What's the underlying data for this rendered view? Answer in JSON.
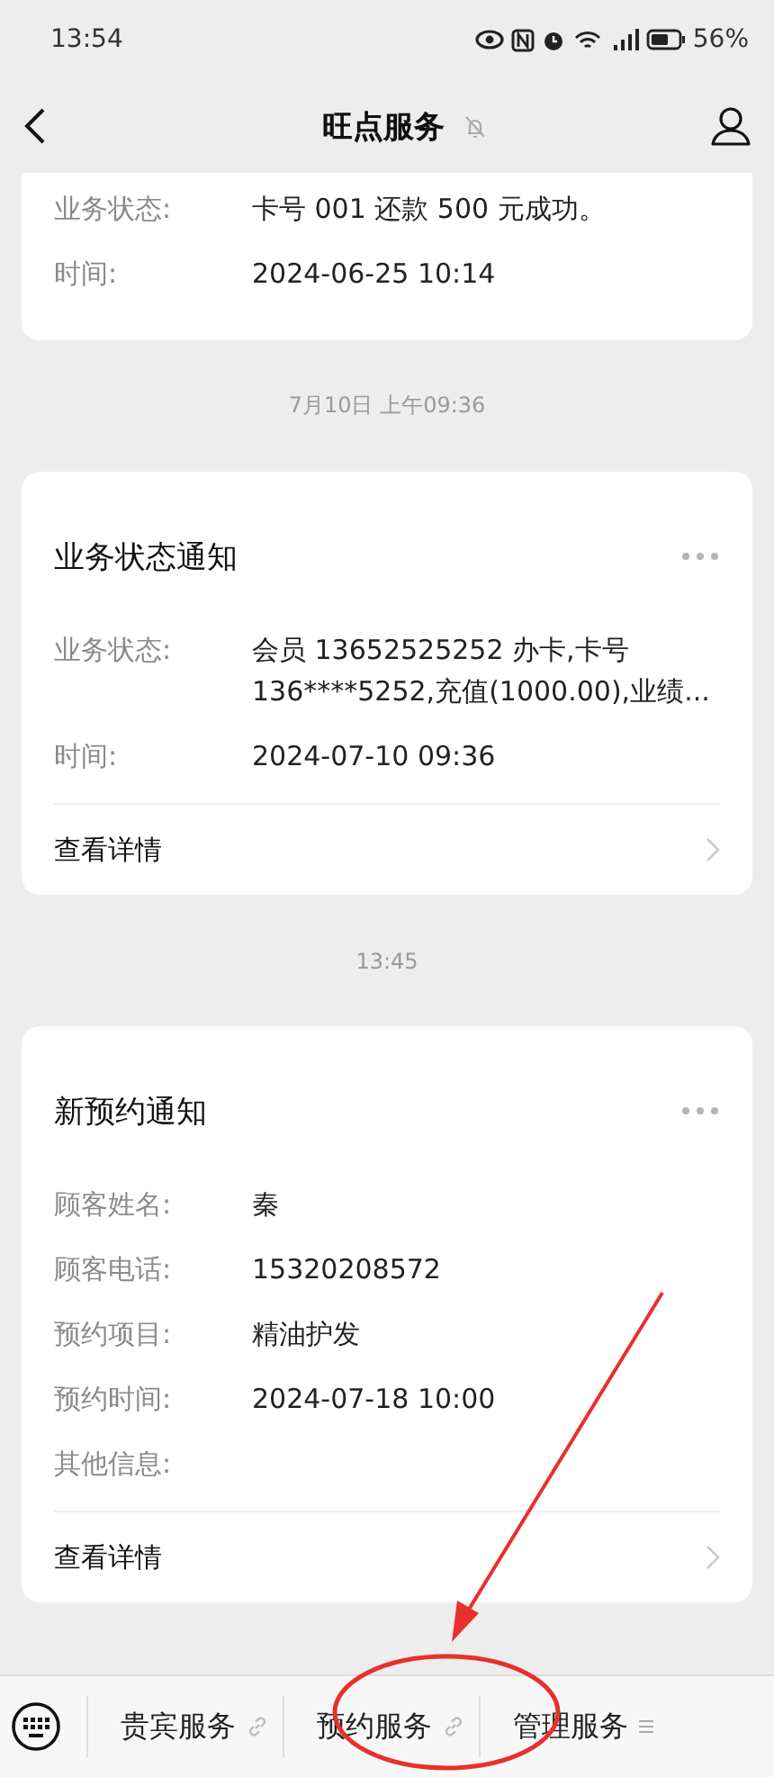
{
  "status_bar": {
    "time": "13:54",
    "battery": "56%"
  },
  "nav": {
    "title": "旺点服务",
    "muted": true
  },
  "messages": [
    {
      "kind": "card",
      "cut_top": true,
      "fields": [
        {
          "label": "业务状态:",
          "value": "卡号 001 还款 500 元成功。"
        },
        {
          "label": "时间:",
          "value": "2024-06-25 10:14"
        }
      ]
    },
    {
      "kind": "timestamp",
      "text": "7月10日 上午09:36"
    },
    {
      "kind": "card",
      "cut_top": false,
      "title": "业务状态通知",
      "fields": [
        {
          "label": "业务状态:",
          "value": "会员 13652525252 办卡,卡号 136****5252,充值(1000.00),业绩..."
        },
        {
          "label": "时间:",
          "value": "2024-07-10 09:36"
        }
      ],
      "details": "查看详情"
    },
    {
      "kind": "timestamp",
      "text": "13:45"
    },
    {
      "kind": "card",
      "cut_top": false,
      "title": "新预约通知",
      "fields": [
        {
          "label": "顾客姓名:",
          "value": "秦"
        },
        {
          "label": "顾客电话:",
          "value": "15320208572"
        },
        {
          "label": "预约项目:",
          "value": "精油护发"
        },
        {
          "label": "预约时间:",
          "value": "2024-07-18 10:00"
        },
        {
          "label": "其他信息:"
        }
      ],
      "details": "查看详情"
    }
  ],
  "menu": [
    {
      "label": "贵宾服务",
      "kind": "link"
    },
    {
      "label": "预约服务",
      "kind": "link"
    },
    {
      "label": "管理服务",
      "kind": "submenu"
    }
  ],
  "annotation": {
    "circle": true,
    "arrow": true
  }
}
